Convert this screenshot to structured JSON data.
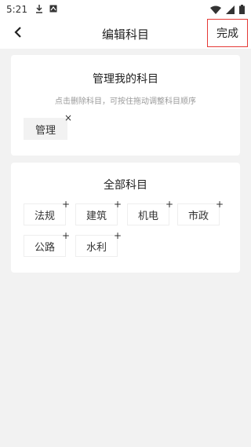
{
  "status_bar": {
    "time": "5:21",
    "icons": [
      "download-icon",
      "notification-icon",
      "wifi-icon",
      "signal-icon",
      "battery-icon"
    ]
  },
  "nav": {
    "title": "编辑科目",
    "done_label": "完成"
  },
  "mine": {
    "title": "管理我的科目",
    "hint": "点击删除科目，可按住拖动调整科目顺序",
    "items": [
      {
        "label": "管理",
        "mark": "×"
      }
    ]
  },
  "all": {
    "title": "全部科目",
    "items": [
      {
        "label": "法规",
        "mark": "+"
      },
      {
        "label": "建筑",
        "mark": "+"
      },
      {
        "label": "机电",
        "mark": "+"
      },
      {
        "label": "市政",
        "mark": "+"
      },
      {
        "label": "公路",
        "mark": "+"
      },
      {
        "label": "水利",
        "mark": "+"
      }
    ]
  },
  "colors": {
    "highlight_border": "#e53935",
    "background": "#f2f2f2",
    "card": "#ffffff"
  }
}
